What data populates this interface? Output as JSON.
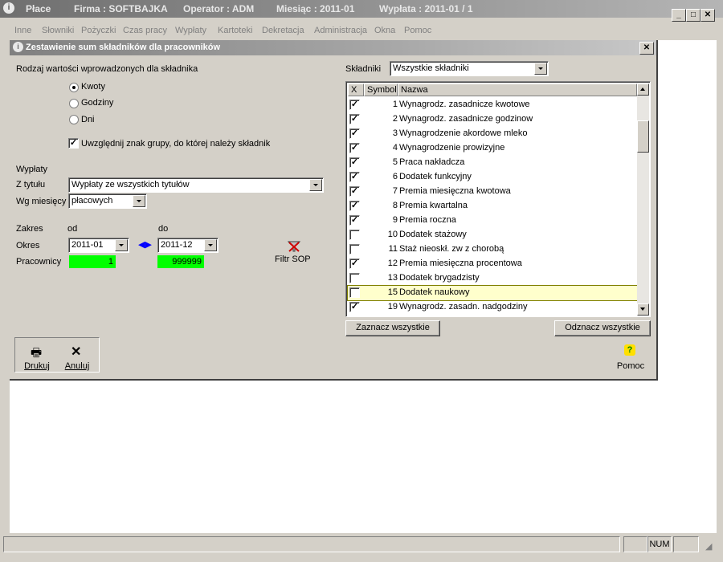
{
  "app": {
    "title_name": "Płace",
    "firma": "Firma : SOFTBAJKA",
    "operator": "Operator : ADM",
    "miesiac": "Miesiąc : 2011-01",
    "wyplata": "Wypłata : 2011-01 /  1"
  },
  "menu": [
    "Inne",
    "Słowniki",
    "Pożyczki",
    "Czas pracy",
    "Wypłaty",
    "Kartoteki",
    "Dekretacja",
    "Administracja",
    "Okna",
    "Pomoc"
  ],
  "dialog": {
    "title": "Zestawienie sum składników dla pracowników",
    "rodzaj_label": "Rodzaj wartości wprowadzonych dla składnika",
    "radios": [
      "Kwoty",
      "Godziny",
      "Dni"
    ],
    "checkbox_label": "Uwzględnij znak grupy, do której należy składnik",
    "wyplaty_label": "Wypłaty",
    "z_tytulu_label": "Z tytułu",
    "z_tytulu_value": "Wypłaty ze wszystkich tytułów",
    "wg_miesiecy_label": "Wg miesięcy",
    "wg_miesiecy_value": "płacowych",
    "zakres_label": "Zakres",
    "od_label": "od",
    "do_label": "do",
    "okres_label": "Okres",
    "okres_od": "2011-01",
    "okres_do": "2011-12",
    "pracownicy_label": "Pracownicy",
    "prac_od": "1",
    "prac_do": "999999",
    "filtr_label": "Filtr SOP",
    "skladniki_label": "Składniki",
    "skladniki_value": "Wszystkie składniki",
    "grid_headers": {
      "x": "X",
      "symbol": "Symbol",
      "nazwa": "Nazwa"
    },
    "zaznacz_label": "Zaznacz wszystkie",
    "odznacz_label": "Odznacz wszystkie",
    "drukuj_label": "Drukuj",
    "anuluj_label": "Anuluj",
    "pomoc_label": "Pomoc"
  },
  "rows": [
    {
      "checked": true,
      "symbol": "1",
      "name": "Wynagrodz. zasadnicze kwotowe"
    },
    {
      "checked": true,
      "symbol": "2",
      "name": "Wynagrodz. zasadnicze godzinow"
    },
    {
      "checked": true,
      "symbol": "3",
      "name": "Wynagrodzenie  akordowe mleko"
    },
    {
      "checked": true,
      "symbol": "4",
      "name": "Wynagrodzenie  prowizyjne"
    },
    {
      "checked": true,
      "symbol": "5",
      "name": "Praca nakładcza"
    },
    {
      "checked": true,
      "symbol": "6",
      "name": "Dodatek funkcyjny"
    },
    {
      "checked": true,
      "symbol": "7",
      "name": "Premia miesięczna kwotowa"
    },
    {
      "checked": true,
      "symbol": "8",
      "name": "Premia kwartalna"
    },
    {
      "checked": true,
      "symbol": "9",
      "name": "Premia roczna"
    },
    {
      "checked": false,
      "symbol": "10",
      "name": "Dodatek stażowy"
    },
    {
      "checked": false,
      "symbol": "11",
      "name": "Staż nieoskł. zw z chorobą"
    },
    {
      "checked": true,
      "symbol": "12",
      "name": "Premia miesięczna procentowa"
    },
    {
      "checked": false,
      "symbol": "13",
      "name": "Dodatek brygadzisty"
    },
    {
      "checked": false,
      "symbol": "15",
      "name": "Dodatek naukowy",
      "selected": true
    },
    {
      "checked": true,
      "symbol": "19",
      "name": "Wynagrodz. zasadn. nadgodziny"
    }
  ],
  "status": {
    "num": "NUM"
  }
}
